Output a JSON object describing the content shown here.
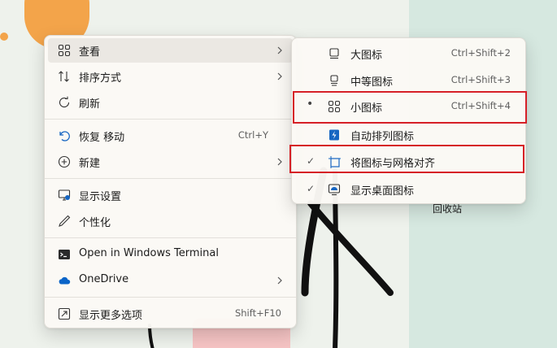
{
  "desktop": {
    "wallpaper_text": "",
    "recycle_bin_label": "回收站"
  },
  "context_menu": {
    "items": [
      {
        "label": "查看",
        "icon": "grid-icon",
        "submenu": true
      },
      {
        "label": "排序方式",
        "icon": "sort-icon",
        "submenu": true
      },
      {
        "label": "刷新",
        "icon": "refresh-icon"
      },
      {
        "label": "恢复 移动",
        "icon": "undo-icon",
        "shortcut": "Ctrl+Y"
      },
      {
        "label": "新建",
        "icon": "plus-circle-icon",
        "submenu": true
      },
      {
        "label": "显示设置",
        "icon": "display-settings-icon"
      },
      {
        "label": "个性化",
        "icon": "pen-icon"
      },
      {
        "label": "Open in Windows Terminal",
        "icon": "terminal-icon"
      },
      {
        "label": "OneDrive",
        "icon": "cloud-icon",
        "submenu": true
      },
      {
        "label": "显示更多选项",
        "icon": "expand-icon",
        "shortcut": "Shift+F10"
      }
    ]
  },
  "view_submenu": {
    "items": [
      {
        "label": "大图标",
        "icon": "large-icons-icon",
        "shortcut": "Ctrl+Shift+2",
        "mark": ""
      },
      {
        "label": "中等图标",
        "icon": "medium-icons-icon",
        "shortcut": "Ctrl+Shift+3",
        "mark": ""
      },
      {
        "label": "小图标",
        "icon": "small-icons-icon",
        "shortcut": "Ctrl+Shift+4",
        "mark": "•"
      },
      {
        "label": "自动排列图标",
        "icon": "auto-arrange-icon",
        "mark": ""
      },
      {
        "label": "将图标与网格对齐",
        "icon": "align-grid-icon",
        "mark": "✓"
      },
      {
        "label": "显示桌面图标",
        "icon": "show-desktop-icon",
        "mark": "✓"
      }
    ]
  },
  "colors": {
    "highlight_border": "#d62027",
    "onedrive_blue": "#0a64c8",
    "accent_blue": "#1766c2"
  }
}
